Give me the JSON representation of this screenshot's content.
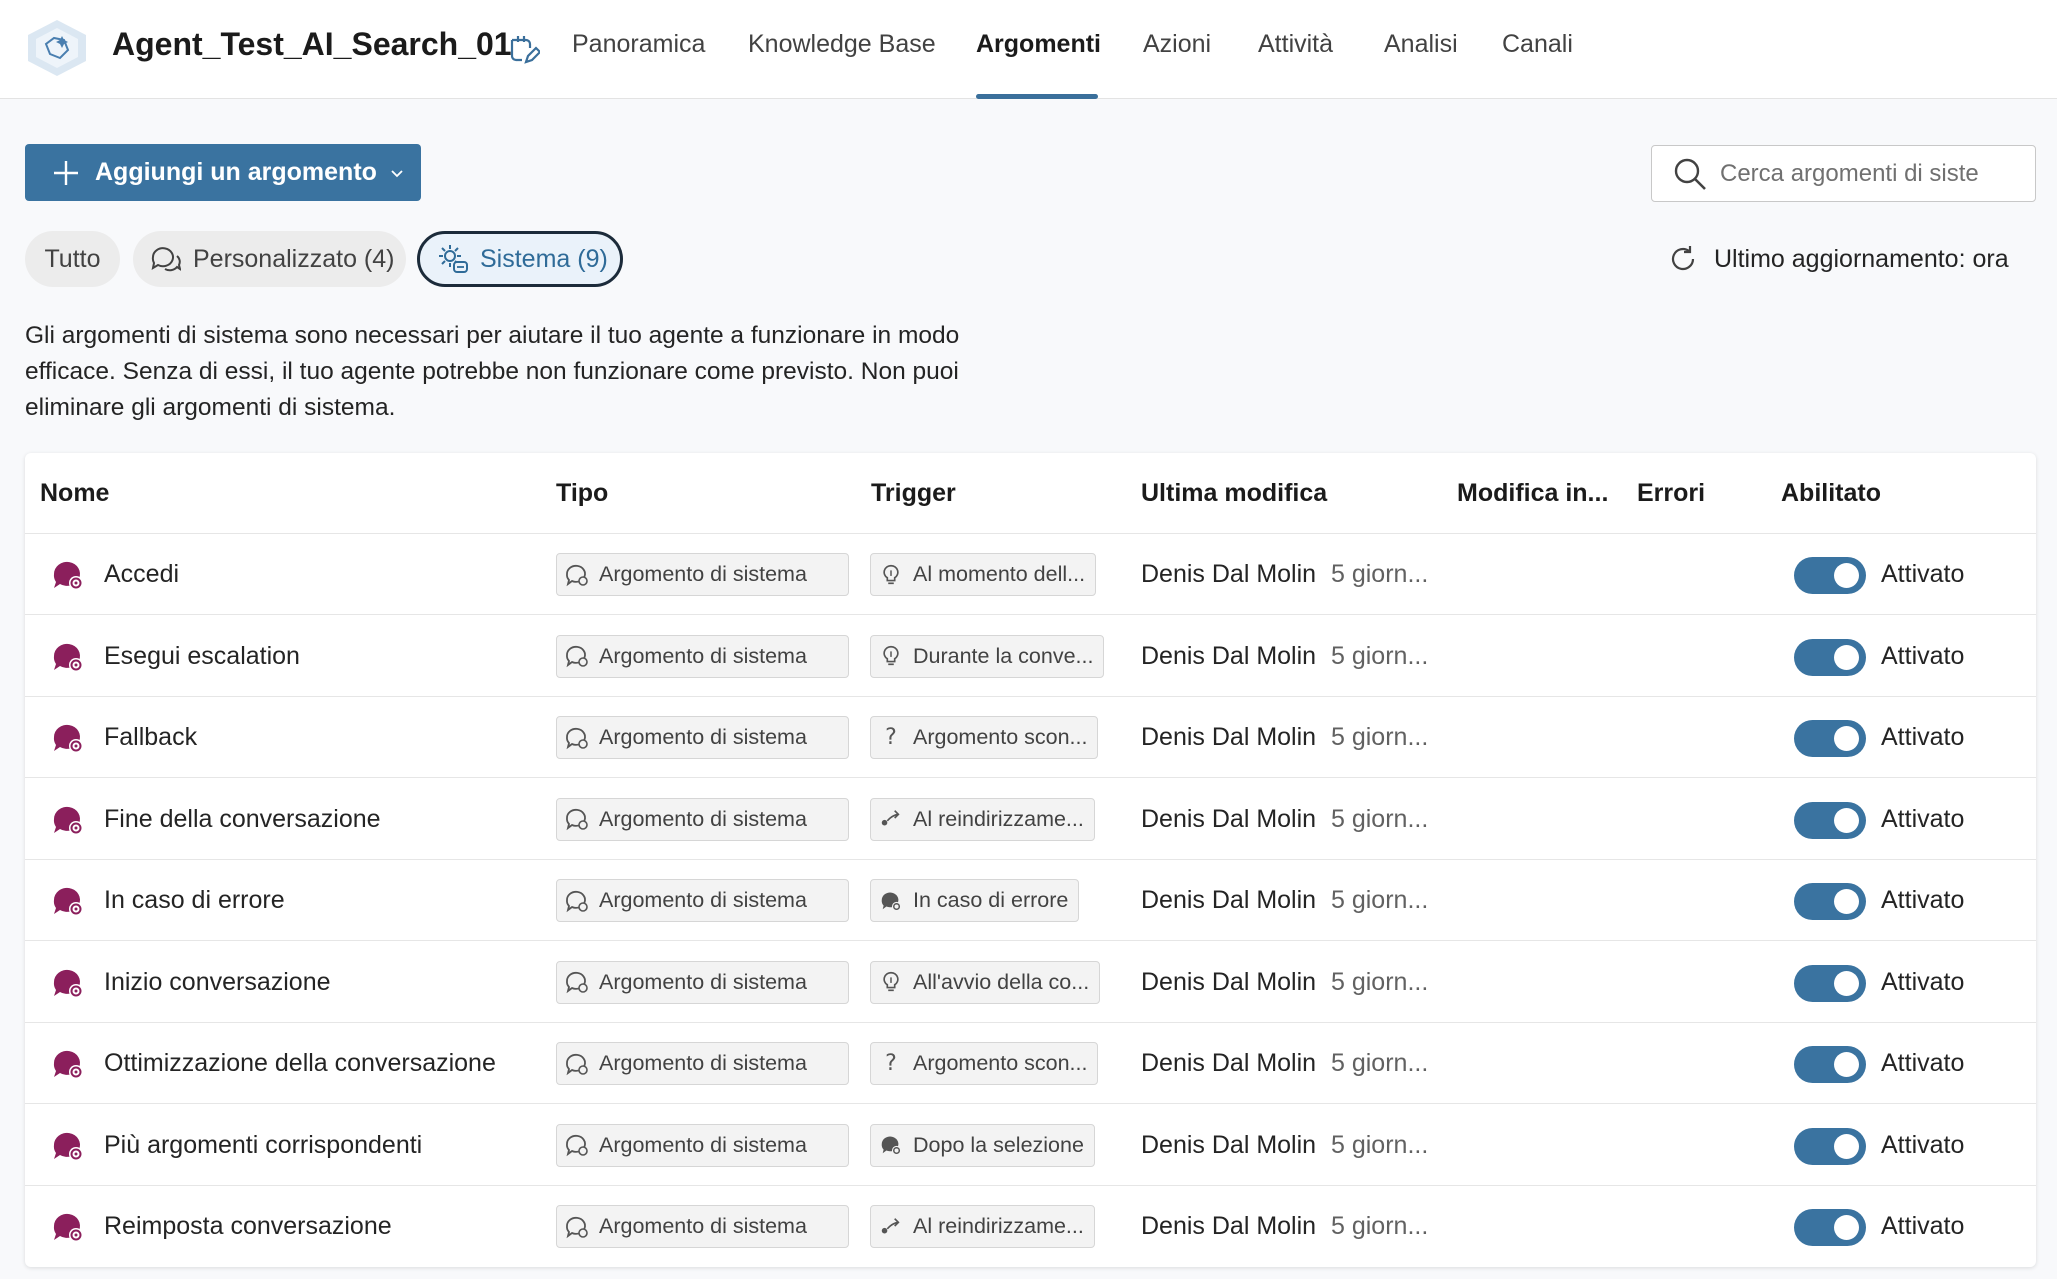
{
  "header": {
    "agent_name": "Agent_Test_AI_Search_01",
    "tabs": [
      {
        "label": "Panoramica"
      },
      {
        "label": "Knowledge Base"
      },
      {
        "label": "Argomenti"
      },
      {
        "label": "Azioni"
      },
      {
        "label": "Attività"
      },
      {
        "label": "Analisi"
      },
      {
        "label": "Canali"
      }
    ],
    "active_tab": "Argomenti"
  },
  "toolbar": {
    "add_label": "Aggiungi un argomento",
    "search_placeholder": "Cerca argomenti di siste"
  },
  "filters": {
    "all": "Tutto",
    "custom": "Personalizzato (4)",
    "system": "Sistema (9)",
    "selected": "Sistema (9)"
  },
  "refresh_label": "Ultimo aggiornamento: ora",
  "description": "Gli argomenti di sistema sono necessari per aiutare il tuo agente a funzionare in modo efficace. Senza di essi, il tuo agente potrebbe non funzionare come previsto. Non puoi eliminare gli argomenti di sistema.",
  "table": {
    "columns": [
      "Nome",
      "Tipo",
      "Trigger",
      "Ultima modifica",
      "Modifica in...",
      "Errori",
      "Abilitato"
    ],
    "rows": [
      {
        "name": "Accedi",
        "type": "Argomento di sistema",
        "trigger": "Al momento dell...",
        "trigger_icon": "lightbulb-icon",
        "modified_by": "Denis Dal Molin",
        "modified_time": "5 giorn...",
        "enabled": "Attivato"
      },
      {
        "name": "Esegui escalation",
        "type": "Argomento di sistema",
        "trigger": "Durante la conve...",
        "trigger_icon": "lightbulb-icon",
        "modified_by": "Denis Dal Molin",
        "modified_time": "5 giorn...",
        "enabled": "Attivato"
      },
      {
        "name": "Fallback",
        "type": "Argomento di sistema",
        "trigger": "Argomento scon...",
        "trigger_icon": "question-icon",
        "modified_by": "Denis Dal Molin",
        "modified_time": "5 giorn...",
        "enabled": "Attivato"
      },
      {
        "name": "Fine della conversazione",
        "type": "Argomento di sistema",
        "trigger": "Al reindirizzame...",
        "trigger_icon": "redirect-icon",
        "modified_by": "Denis Dal Molin",
        "modified_time": "5 giorn...",
        "enabled": "Attivato"
      },
      {
        "name": "In caso di errore",
        "type": "Argomento di sistema",
        "trigger": "In caso di errore",
        "trigger_icon": "error-gear-icon",
        "modified_by": "Denis Dal Molin",
        "modified_time": "5 giorn...",
        "enabled": "Attivato"
      },
      {
        "name": "Inizio conversazione",
        "type": "Argomento di sistema",
        "trigger": "All'avvio della co...",
        "trigger_icon": "lightbulb-icon",
        "modified_by": "Denis Dal Molin",
        "modified_time": "5 giorn...",
        "enabled": "Attivato"
      },
      {
        "name": "Ottimizzazione della conversazione",
        "type": "Argomento di sistema",
        "trigger": "Argomento scon...",
        "trigger_icon": "question-icon",
        "modified_by": "Denis Dal Molin",
        "modified_time": "5 giorn...",
        "enabled": "Attivato"
      },
      {
        "name": "Più argomenti corrispondenti",
        "type": "Argomento di sistema",
        "trigger": "Dopo la selezione",
        "trigger_icon": "error-gear-icon",
        "modified_by": "Denis Dal Molin",
        "modified_time": "5 giorn...",
        "enabled": "Attivato"
      },
      {
        "name": "Reimposta conversazione",
        "type": "Argomento di sistema",
        "trigger": "Al reindirizzame...",
        "trigger_icon": "redirect-icon",
        "modified_by": "Denis Dal Molin",
        "modified_time": "5 giorn...",
        "enabled": "Attivato"
      }
    ]
  },
  "colors": {
    "accent": "#3a73a0",
    "topic_icon": "#8b1f5c",
    "system_pill_bg": "#eaf2fa"
  }
}
